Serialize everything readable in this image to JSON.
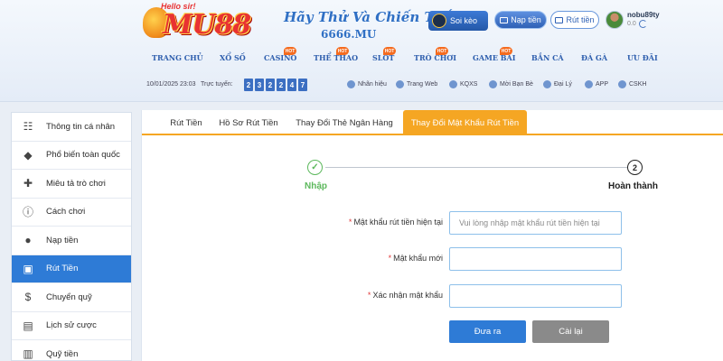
{
  "header": {
    "logo_tag": "Hello sir!",
    "logo_text": "MU88",
    "slogan": "Hãy Thử Và Chiến Thắng!",
    "domain": "6666.MU",
    "soikeo_label": "Soi kèo",
    "naptien_label": "Nạp tiền",
    "ruttien_label": "Rút tiền",
    "username": "nobu89ty",
    "balance": "0.0"
  },
  "nav": [
    {
      "label": "TRANG CHỦ",
      "hot": false
    },
    {
      "label": "XỔ SỐ",
      "hot": false
    },
    {
      "label": "CASINO",
      "hot": true
    },
    {
      "label": "THỂ THAO",
      "hot": true
    },
    {
      "label": "SLOT",
      "hot": true
    },
    {
      "label": "TRÒ CHƠI",
      "hot": true
    },
    {
      "label": "GAME BÀI",
      "hot": true
    },
    {
      "label": "BẮN CÁ",
      "hot": false
    },
    {
      "label": "ĐÁ GÀ",
      "hot": false
    },
    {
      "label": "ƯU ĐÃI",
      "hot": false
    }
  ],
  "hot_label": "HOT",
  "subbar": {
    "date": "10/01/2025 23:03",
    "online_label": "Trực tuyến:",
    "online_digits": [
      "2",
      "3",
      "2",
      "2",
      "4",
      "7"
    ],
    "links": [
      {
        "label": "Nhãn hiệu",
        "icon": "brand-icon"
      },
      {
        "label": "Trang Web",
        "icon": "globe-icon"
      },
      {
        "label": "KQXS",
        "icon": "lottery-icon"
      },
      {
        "label": "Mời Bạn Bè",
        "icon": "invite-icon"
      },
      {
        "label": "Đại Lý",
        "icon": "agent-icon"
      },
      {
        "label": "APP",
        "icon": "phone-icon"
      },
      {
        "label": "CSKH",
        "icon": "support-icon"
      }
    ]
  },
  "sidebar": {
    "items": [
      {
        "label": "Thông tin cá nhân",
        "icon": "id-card-icon",
        "active": false
      },
      {
        "label": "Phổ biến toàn quốc",
        "icon": "diamond-icon",
        "active": false
      },
      {
        "label": "Miêu tả trò chơi",
        "icon": "gamepad-icon",
        "active": false
      },
      {
        "label": "Cách chơi",
        "icon": "info-icon",
        "active": false
      },
      {
        "label": "Nạp tiền",
        "icon": "piggy-bank-icon",
        "active": false
      },
      {
        "label": "Rút Tiền",
        "icon": "withdraw-icon",
        "active": true
      },
      {
        "label": "Chuyển quỹ",
        "icon": "dollar-icon",
        "active": false
      },
      {
        "label": "Lịch sử cược",
        "icon": "history-icon",
        "active": false
      },
      {
        "label": "Quỹ tiền",
        "icon": "fund-icon",
        "active": false
      }
    ]
  },
  "tabs": [
    {
      "label": "Rút Tiền",
      "active": false
    },
    {
      "label": "Hồ Sơ Rút Tiền",
      "active": false
    },
    {
      "label": "Thay Đổi Thẻ Ngân Hàng",
      "active": false
    },
    {
      "label": "Thay Đổi Mật Khẩu Rút Tiền",
      "active": true
    }
  ],
  "stepper": {
    "step1_label": "Nhập",
    "step2_number": "2",
    "step2_label": "Hoàn thành"
  },
  "form": {
    "current_password": {
      "label": "Mật khẩu rút tiền hiện tại",
      "placeholder": "Vui lòng nhập mật khẩu rút tiền hiện tại",
      "value": ""
    },
    "new_password": {
      "label": "Mật khẩu mới",
      "placeholder": "",
      "value": ""
    },
    "confirm_password": {
      "label": "Xác nhận mật khẩu",
      "placeholder": "",
      "value": ""
    },
    "required_mark": "*",
    "submit_label": "Đưa ra",
    "reset_label": "Cài lại"
  },
  "colors": {
    "primary": "#2e7bd6",
    "accent": "#f5a623",
    "success": "#5cb85c",
    "reset": "#8a8a8a"
  }
}
